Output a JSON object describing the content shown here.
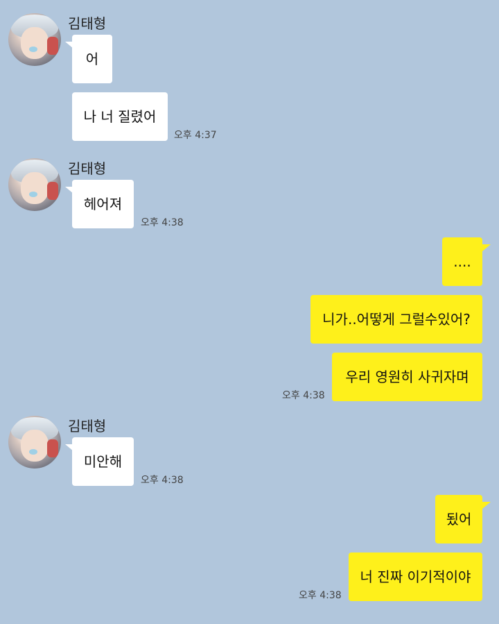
{
  "groups": [
    {
      "sender": "김태형",
      "messages": [
        {
          "text": "어"
        },
        {
          "text": "나 너 질렸어",
          "time": "오후 4:37"
        }
      ]
    },
    {
      "sender": "김태형",
      "messages": [
        {
          "text": "헤어져",
          "time": "오후 4:38"
        }
      ]
    },
    {
      "sender": "me",
      "messages": [
        {
          "text": "...."
        },
        {
          "text": "니가..어떻게 그럴수있어?"
        },
        {
          "text": "우리 영원히 사귀자며",
          "time": "오후 4:38"
        }
      ]
    },
    {
      "sender": "김태형",
      "messages": [
        {
          "text": "미안해",
          "time": "오후 4:38"
        }
      ]
    },
    {
      "sender": "me",
      "messages": [
        {
          "text": "됬어"
        },
        {
          "text": "너 진짜 이기적이야",
          "time": "오후 4:38"
        }
      ]
    }
  ]
}
